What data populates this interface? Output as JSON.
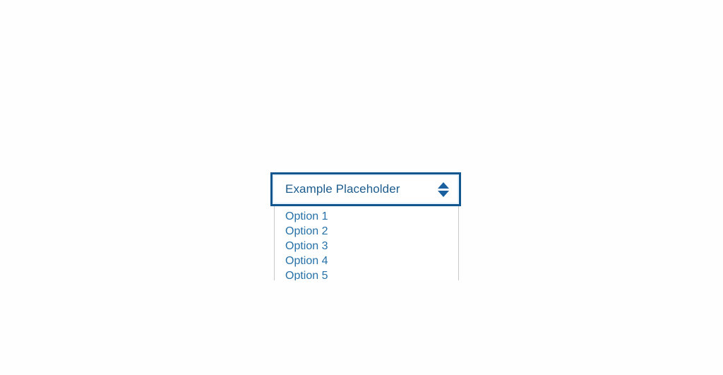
{
  "page": {
    "background_color": "#fefefe"
  },
  "combobox": {
    "name": "example-select",
    "placeholder": "Example Placeholder",
    "value": "Example Placeholder",
    "expanded": true,
    "border_color": "#12568f",
    "text_color": "#1d5c8e",
    "option_text_color": "#2771a8",
    "stepper": {
      "up_icon": "triangle-up-icon",
      "down_icon": "triangle-down-icon",
      "color": "#1a5f9e"
    },
    "options": [
      {
        "label": "Option 1"
      },
      {
        "label": "Option 2"
      },
      {
        "label": "Option 3"
      },
      {
        "label": "Option 4"
      },
      {
        "label": "Option 5"
      }
    ]
  }
}
